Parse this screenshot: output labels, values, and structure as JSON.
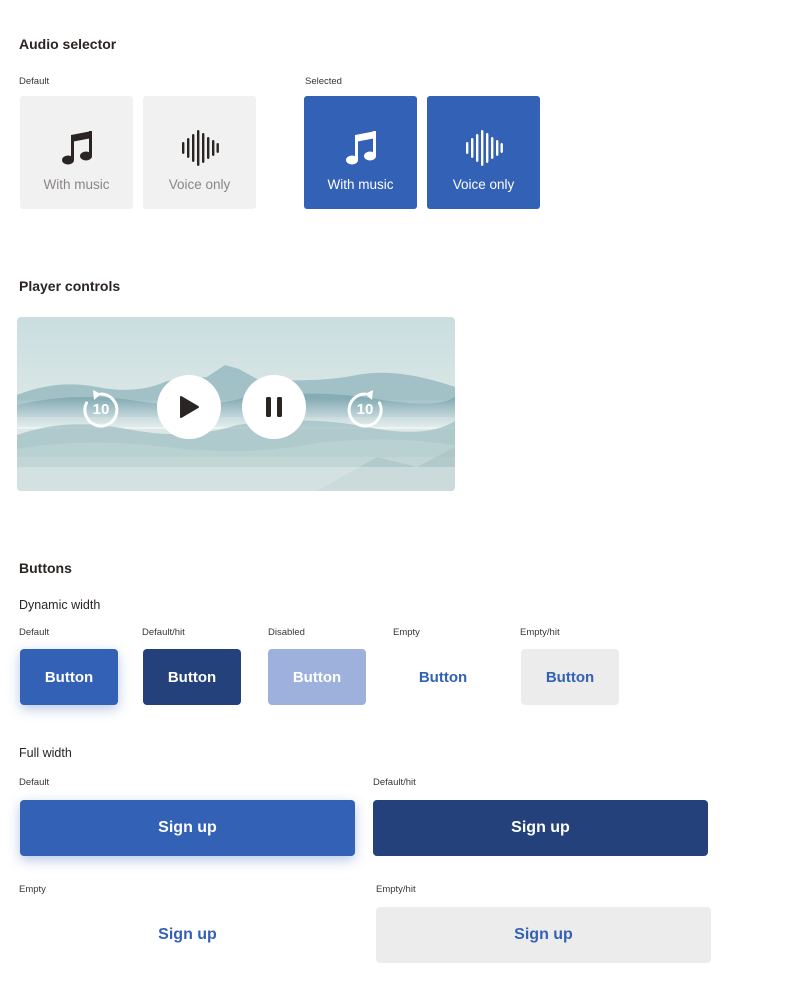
{
  "audio_selector": {
    "title": "Audio selector",
    "default_caption": "Default",
    "selected_caption": "Selected",
    "cards": [
      {
        "label": "With music",
        "icon": "music-note-icon"
      },
      {
        "label": "Voice only",
        "icon": "waveform-icon"
      }
    ]
  },
  "player_controls": {
    "title": "Player controls",
    "rewind_label": "10",
    "forward_label": "10",
    "icons": [
      "rewind-10-icon",
      "play-icon",
      "pause-icon",
      "forward-10-icon"
    ]
  },
  "buttons": {
    "title": "Buttons",
    "dynamic_width": {
      "title": "Dynamic width",
      "states": [
        {
          "caption": "Default",
          "label": "Button"
        },
        {
          "caption": "Default/hit",
          "label": "Button"
        },
        {
          "caption": "Disabled",
          "label": "Button"
        },
        {
          "caption": "Empty",
          "label": "Button"
        },
        {
          "caption": "Empty/hit",
          "label": "Button"
        }
      ]
    },
    "full_width": {
      "title": "Full width",
      "states": [
        {
          "caption": "Default",
          "label": "Sign up"
        },
        {
          "caption": "Default/hit",
          "label": "Sign up"
        },
        {
          "caption": "Empty",
          "label": "Sign up"
        },
        {
          "caption": "Empty/hit",
          "label": "Sign up"
        }
      ]
    }
  },
  "colors": {
    "primary": "#3361b5",
    "primary_hit": "#24417c",
    "disabled": "#9db1dc",
    "empty_hit_bg": "#ececec",
    "card_default_bg": "#f1f1f1",
    "text_dark": "#2a2523",
    "text_muted": "#8a8684"
  }
}
